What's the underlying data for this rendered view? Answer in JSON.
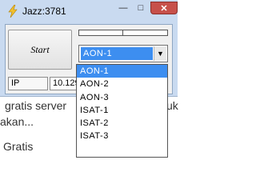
{
  "window": {
    "title": "Jazz:3781",
    "controls": {
      "minimize": "—",
      "maximize": "□",
      "close": "✕"
    }
  },
  "start_button": {
    "label": "Start"
  },
  "progress": {
    "value": 0
  },
  "combo": {
    "selected": "AON-1",
    "options": [
      "AON-1",
      "AON-2",
      "AON-3",
      "ISAT-1",
      "ISAT-2",
      "ISAT-3"
    ]
  },
  "ip": {
    "label": "IP",
    "value": "10.129"
  },
  "background_text": {
    "line1": "gratis  server",
    "line1_suffix": "uk",
    "line2": "akan...",
    "line3": "Gratis"
  },
  "colors": {
    "selection": "#3d8ef0",
    "close": "#c7504a",
    "window_frame": "#c9daf0"
  }
}
